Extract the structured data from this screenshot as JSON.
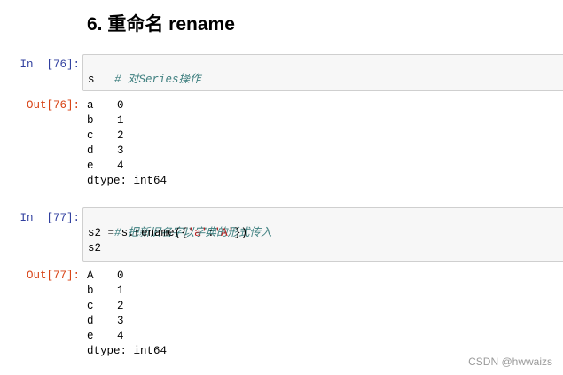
{
  "section_heading": "6. 重命名 rename",
  "cells": [
    {
      "in_prompt": "In  [76]:",
      "out_prompt": "Out[76]:",
      "code": {
        "comment": "# 对Series操作",
        "line2": "s"
      },
      "output": {
        "rows": [
          {
            "index": "a",
            "value": "0"
          },
          {
            "index": "b",
            "value": "1"
          },
          {
            "index": "c",
            "value": "2"
          },
          {
            "index": "d",
            "value": "3"
          },
          {
            "index": "e",
            "value": "4"
          }
        ],
        "dtype": "dtype: int64"
      }
    },
    {
      "in_prompt": "In  [77]:",
      "out_prompt": "Out[77]:",
      "code": {
        "comment": "# 把新旧名字以字典的形式传入",
        "line2_var": "s2",
        "line2_eq": "=",
        "line2_call_open": "s.rename({",
        "line2_key": "'a'",
        "line2_colon": ":",
        "line2_val": "'A'",
        "line2_call_close": "})",
        "line3": "s2"
      },
      "output": {
        "rows": [
          {
            "index": "A",
            "value": "0"
          },
          {
            "index": "b",
            "value": "1"
          },
          {
            "index": "c",
            "value": "2"
          },
          {
            "index": "d",
            "value": "3"
          },
          {
            "index": "e",
            "value": "4"
          }
        ],
        "dtype": "dtype: int64"
      }
    }
  ],
  "watermark": "CSDN @hwwaizs"
}
